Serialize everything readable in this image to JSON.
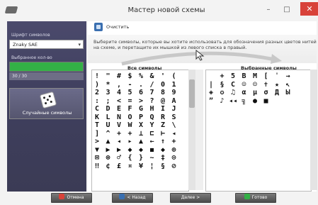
{
  "window": {
    "title": "Мастер новой схемы",
    "minimize": "–",
    "maximize": "□",
    "close": "✕"
  },
  "left_panel": {
    "font_label": "Шрифт символов",
    "font_value": "Znaky SAE",
    "selected_label": "Выбранное кол-во",
    "progress_fraction": 1.0,
    "count_text": "30 / 30",
    "random_button": "Случайные символы"
  },
  "toolbar": {
    "clear_label": "Очистить"
  },
  "instruction": "Выберите символы, которые вы хотите использовать для обозначения разных цветов нитей на схеме, и перетащите их мышкой из левого списка в правый.",
  "all_symbols": {
    "title": "Все символы",
    "rows": [
      [
        "!",
        "\"",
        "#",
        "$",
        "%",
        "&",
        "'",
        "("
      ],
      [
        ")",
        "*",
        ",",
        "-",
        ".",
        "/",
        "0",
        "1"
      ],
      [
        "2",
        "3",
        "4",
        "5",
        "6",
        "7",
        "8",
        "9"
      ],
      [
        ":",
        ";",
        "<",
        "=",
        ">",
        "?",
        "@",
        "A"
      ],
      [
        "C",
        "D",
        "E",
        "F",
        "G",
        "H",
        "I",
        "J"
      ],
      [
        "K",
        "L",
        "N",
        "O",
        "P",
        "Q",
        "R",
        "S"
      ],
      [
        "T",
        "U",
        "V",
        "W",
        "X",
        "Y",
        "Z",
        "\\"
      ],
      [
        "]",
        "^",
        "+",
        "+",
        "⊥",
        "⊏",
        "⊢",
        "◂"
      ],
      [
        ">",
        "▲",
        "◂",
        "▸",
        "▲",
        "←",
        "↑",
        "+"
      ],
      [
        "▼",
        "▶",
        "▶",
        "◆",
        "◆",
        "◼",
        "◆",
        "⊕"
      ],
      [
        "⊠",
        "⊗",
        "♂",
        "{",
        "}",
        "~",
        "‡",
        "⊙"
      ],
      [
        "‼",
        "¢",
        "£",
        "¤",
        "¥",
        "¦",
        "§",
        "⊘"
      ]
    ]
  },
  "selected_symbols": {
    "title": "Выбранные символы",
    "rows": [
      [
        "",
        "+",
        "5",
        "B",
        "M",
        "[",
        "ˈ",
        "→"
      ],
      [
        "|",
        "§",
        "C",
        "☺",
        "☹",
        "✝",
        "★",
        "↖"
      ],
      [
        "◈",
        "✪",
        "♫",
        "α",
        "μ",
        "σ",
        "Д",
        "Ы"
      ],
      [
        "”",
        "♪",
        "◂◂",
        "╗",
        "●",
        "■",
        "",
        ""
      ]
    ]
  },
  "buttons": {
    "cancel": "Отмена",
    "back": "< Назад",
    "next": "Далее >",
    "finish": "Готово"
  },
  "colors": {
    "accent_green": "#33b046",
    "close_red": "#d8423a",
    "panel_purple": "#4b4a6c"
  }
}
